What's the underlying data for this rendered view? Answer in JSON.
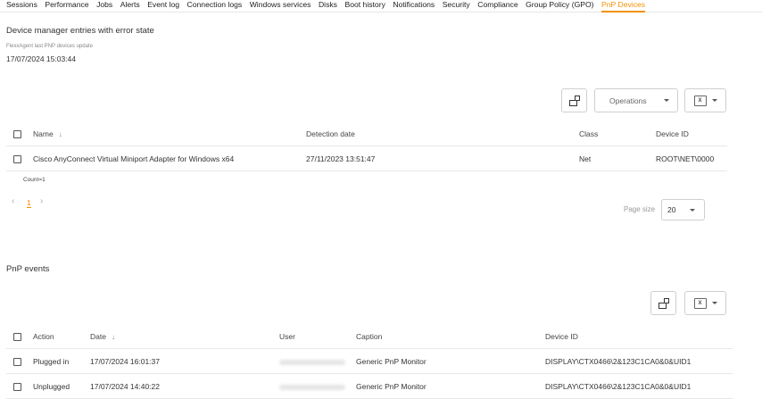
{
  "tabs": [
    {
      "label": "Sessions",
      "active": false
    },
    {
      "label": "Performance",
      "active": false
    },
    {
      "label": "Jobs",
      "active": false
    },
    {
      "label": "Alerts",
      "active": false
    },
    {
      "label": "Event log",
      "active": false
    },
    {
      "label": "Connection logs",
      "active": false
    },
    {
      "label": "Windows services",
      "active": false
    },
    {
      "label": "Disks",
      "active": false
    },
    {
      "label": "Boot history",
      "active": false
    },
    {
      "label": "Notifications",
      "active": false
    },
    {
      "label": "Security",
      "active": false
    },
    {
      "label": "Compliance",
      "active": false
    },
    {
      "label": "Group Policy (GPO)",
      "active": false
    },
    {
      "label": "PnP Devices",
      "active": true
    }
  ],
  "device_section": {
    "title": "Device manager entries with error state",
    "last_update_label": "FlexxAgent last PNP devices update",
    "last_update_value": "17/07/2024 15:03:44",
    "operations_label": "Operations",
    "excel_icon_text": "X",
    "columns": {
      "name": "Name",
      "detection_date": "Detection date",
      "class": "Class",
      "device_id": "Device ID"
    },
    "rows": [
      {
        "name": "Cisco AnyConnect Virtual Miniport Adapter for Windows x64",
        "detection_date": "27/11/2023 13:51:47",
        "class": "Net",
        "device_id": "ROOT\\NET\\0000"
      }
    ],
    "count_text": "Count=1",
    "pager": {
      "prev": "‹",
      "current_page": "1",
      "next": "›"
    },
    "page_size_label": "Page size",
    "page_size_value": "20"
  },
  "events_section": {
    "title": "PnP events",
    "excel_icon_text": "X",
    "columns": {
      "action": "Action",
      "date": "Date",
      "user": "User",
      "caption": "Caption",
      "device_id": "Device ID"
    },
    "rows": [
      {
        "action": "Plugged in",
        "date": "17/07/2024 16:01:37",
        "caption": "Generic PnP Monitor",
        "device_id": "DISPLAY\\CTX0466\\2&123C1CA0&0&UID1"
      },
      {
        "action": "Unplugged",
        "date": "17/07/2024 14:40:22",
        "caption": "Generic PnP Monitor",
        "device_id": "DISPLAY\\CTX0466\\2&123C1CA0&0&UID1"
      }
    ]
  },
  "colors": {
    "accent": "#f39200",
    "border": "#cfcfcf"
  }
}
